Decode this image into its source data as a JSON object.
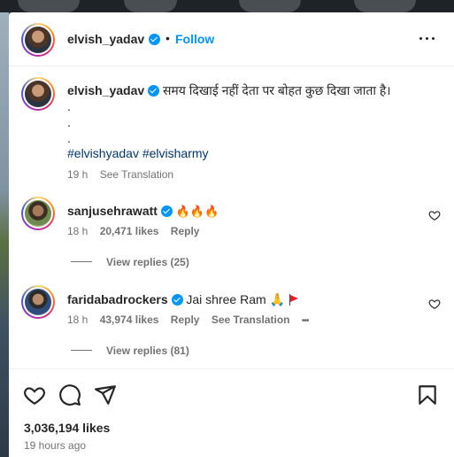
{
  "header": {
    "username": "elvish_yadav",
    "separator": "•",
    "follow_label": "Follow",
    "more_icon": "more-horizontal-icon"
  },
  "caption": {
    "username": "elvish_yadav",
    "text": "समय दिखाई नहीं देता पर बोहत कुछ दिखा जाता है।",
    "dots": [
      ".",
      ".",
      "."
    ],
    "hashtags": "#elvishyadav #elvisharmy",
    "time": "19 h",
    "see_translation": "See Translation"
  },
  "comments": [
    {
      "username": "sanjusehrawatt",
      "text": "🔥🔥🔥",
      "time": "18 h",
      "likes": "20,471 likes",
      "reply": "Reply",
      "view_replies": "View replies (25)"
    },
    {
      "username": "faridabadrockers",
      "text": "Jai shree Ram 🙏",
      "time": "18 h",
      "likes": "43,974 likes",
      "reply": "Reply",
      "see_translation": "See Translation",
      "more": "•••",
      "view_replies": "View replies (81)"
    }
  ],
  "footer": {
    "likes": "3,036,194 likes",
    "time_ago": "19 hours ago",
    "icons": [
      "heart-icon",
      "comment-icon",
      "share-icon",
      "bookmark-icon"
    ]
  },
  "colors": {
    "link_blue": "#0095f6",
    "hashtag": "#00376b",
    "muted": "#737373",
    "text": "#262626"
  }
}
